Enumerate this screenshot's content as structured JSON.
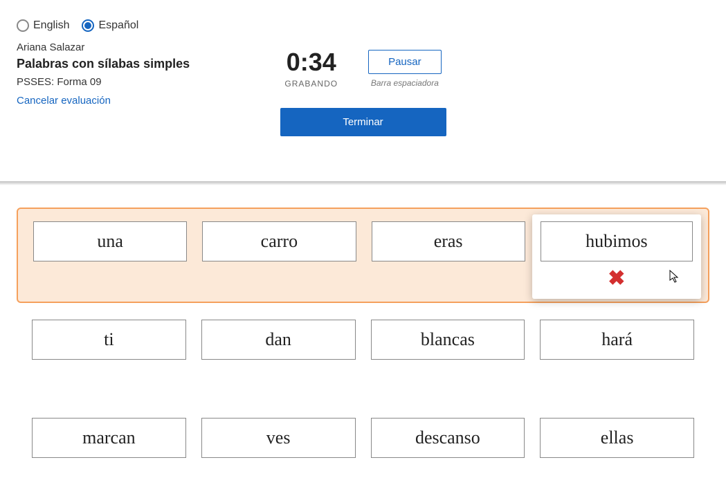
{
  "lang": {
    "english": "English",
    "spanish": "Español",
    "selected": "spanish"
  },
  "info": {
    "student": "Ariana Salazar",
    "title": "Palabras con sílabas simples",
    "form": "PSSES: Forma 09",
    "cancel": "Cancelar evaluación"
  },
  "timer": {
    "value": "0:34",
    "label": "GRABANDO"
  },
  "pause": {
    "label": "Pausar",
    "hint": "Barra espaciadora"
  },
  "finish": {
    "label": "Terminar"
  },
  "words": {
    "row1": [
      "una",
      "carro",
      "eras",
      "hubimos"
    ],
    "row2": [
      "ti",
      "dan",
      "blancas",
      "hará"
    ],
    "row3": [
      "marcan",
      "ves",
      "descanso",
      "ellas"
    ]
  },
  "icons": {
    "x": "✖"
  }
}
